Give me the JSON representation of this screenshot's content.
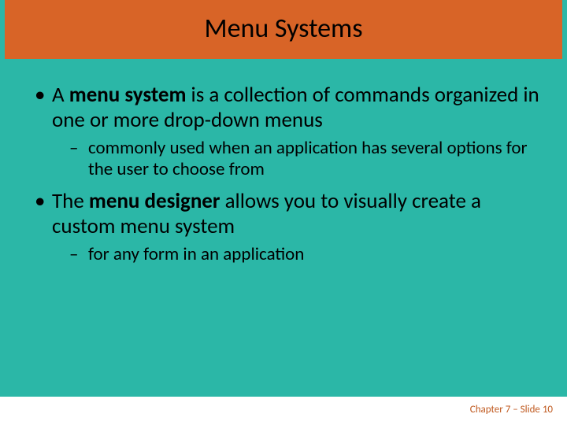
{
  "title": "Menu Systems",
  "bullets": [
    {
      "pre": "A ",
      "bold": "menu system",
      "post": " is a collection of commands organized in one or more drop-down menus",
      "sub": "commonly used when an application has several options for the user to choose from"
    },
    {
      "pre": "The ",
      "bold": "menu designer",
      "post": " allows you to visually create a custom menu system",
      "sub": " for any form in an application"
    }
  ],
  "footer": "Chapter 7 – Slide 10"
}
